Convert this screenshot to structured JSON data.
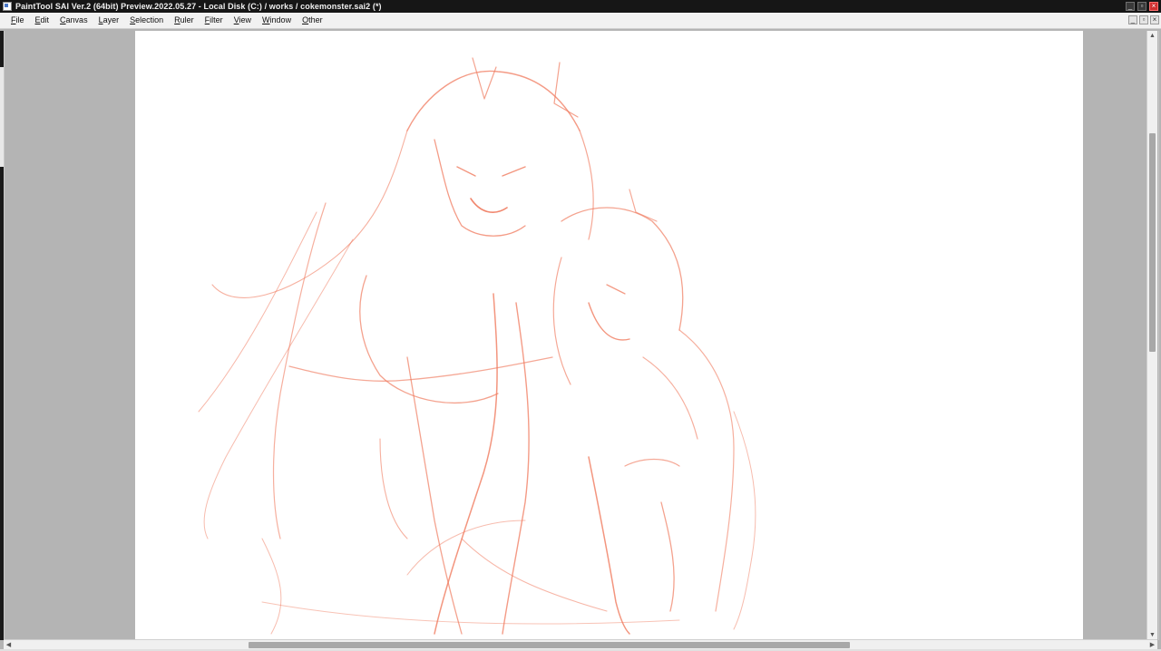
{
  "window": {
    "title": "PaintTool SAI Ver.2 (64bit) Preview.2022.05.27 - Local Disk (C:) / works / cokemonster.sai2 (*)",
    "controls": {
      "minimize": "_",
      "restore": "▫",
      "close": "×"
    }
  },
  "menubar": {
    "items": [
      {
        "label": "File",
        "access": "F",
        "rest": "ile"
      },
      {
        "label": "Edit",
        "access": "E",
        "rest": "dit"
      },
      {
        "label": "Canvas",
        "access": "C",
        "rest": "anvas"
      },
      {
        "label": "Layer",
        "access": "L",
        "rest": "ayer"
      },
      {
        "label": "Selection",
        "access": "S",
        "rest": "election"
      },
      {
        "label": "Ruler",
        "access": "R",
        "rest": "uler"
      },
      {
        "label": "Filter",
        "access": "F",
        "rest": "ilter"
      },
      {
        "label": "View",
        "access": "V",
        "rest": "iew"
      },
      {
        "label": "Window",
        "access": "W",
        "rest": "indow"
      },
      {
        "label": "Other",
        "access": "O",
        "rest": "ther"
      }
    ],
    "mdi_controls": {
      "minimize": "_",
      "restore": "▫",
      "close": "×"
    }
  },
  "canvas": {
    "background": "#ffffff",
    "stroke_color": "#f07a5e",
    "workspace_color": "#b4b4b4"
  },
  "scrollbars": {
    "vertical": {
      "up": "▲",
      "down": "▼",
      "position": 0.25,
      "visible_fraction": 0.37
    },
    "horizontal": {
      "left": "◀",
      "right": "▶",
      "position": 0.22,
      "visible_fraction": 0.53
    }
  },
  "icons": {
    "app": "app-icon",
    "minimize": "minimize-icon",
    "restore": "restore-icon",
    "close": "close-icon"
  }
}
